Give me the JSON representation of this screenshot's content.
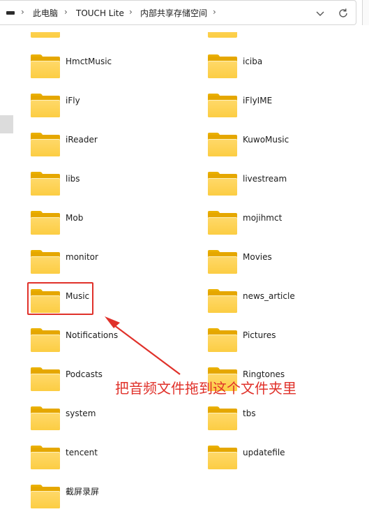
{
  "breadcrumb": {
    "items": [
      "此电脑",
      "TOUCH Lite",
      "内部共享存储空间"
    ],
    "separator": "›"
  },
  "folders": {
    "left": [
      "HmctMusic",
      "iFly",
      "iReader",
      "libs",
      "Mob",
      "monitor",
      "Music",
      "Notifications",
      "Podcasts",
      "system",
      "tencent",
      "截屏录屏"
    ],
    "right": [
      "iciba",
      "iFlyIME",
      "KuwoMusic",
      "livestream",
      "mojihmct",
      "Movies",
      "news_article",
      "Pictures",
      "Ringtones",
      "tbs",
      "updatefile"
    ]
  },
  "annotation": {
    "text": "把音频文件拖到这个文件夹里",
    "color": "#e0312a"
  },
  "colors": {
    "folder_front": "#fccd43",
    "folder_back": "#e5a700",
    "highlight": "#e0312a"
  },
  "icons": [
    "computer-icon",
    "chevron-down-icon",
    "refresh-icon",
    "folder-icon"
  ]
}
